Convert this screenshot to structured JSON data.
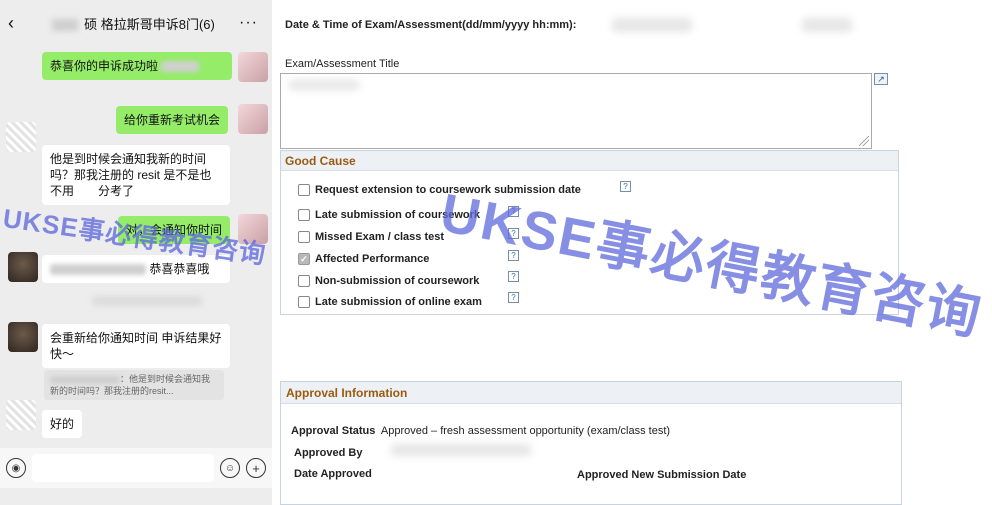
{
  "chat": {
    "header": {
      "back_icon": "‹",
      "title": "硕 格拉斯哥申诉8门(6)",
      "more_icon": "···"
    },
    "messages": [
      {
        "side": "self",
        "text": "恭喜你的申诉成功啦"
      },
      {
        "side": "self",
        "text": "给你重新考试机会"
      },
      {
        "side": "other",
        "text": "他是到时候会通知我新的时间吗？那我注册的 resit 是不是也不用　　分考了"
      },
      {
        "side": "self",
        "text": "对，会通知你时间"
      },
      {
        "side": "other",
        "text": "恭喜恭喜哦"
      },
      {
        "side": "other",
        "text": "会重新给你通知时间 申诉结果好快～"
      },
      {
        "side": "quote",
        "text": "：他是到时候会通知我新的时间吗？那我注册的resit..."
      },
      {
        "side": "other",
        "text": "好的"
      }
    ],
    "input": {
      "voice_icon": "voice-icon",
      "emoji_icon": "emoji-icon",
      "plus_icon": "plus-icon"
    }
  },
  "form": {
    "date_label": "Date & Time of Exam/Assessment(dd/mm/yyyy hh:mm):",
    "title_label": "Exam/Assessment Title",
    "good_cause": {
      "heading": "Good Cause",
      "options": [
        {
          "label": "Request extension to coursework submission date",
          "checked": false
        },
        {
          "label": "Late submission of coursework",
          "checked": false
        },
        {
          "label": "Missed Exam / class test",
          "checked": false
        },
        {
          "label": "Affected Performance",
          "checked": true
        },
        {
          "label": "Non-submission of coursework",
          "checked": false
        },
        {
          "label": "Late submission of online exam",
          "checked": false
        }
      ],
      "help_glyph": "?"
    },
    "approval": {
      "heading": "Approval Information",
      "status_label": "Approval Status",
      "status_value": "Approved – fresh assessment opportunity (exam/class test)",
      "approved_by_label": "Approved By",
      "date_approved_label": "Date Approved",
      "new_submission_label": "Approved New Submission Date"
    }
  },
  "watermark": {
    "text": "UKSE事必得教育咨询",
    "color": "#5f69dc"
  }
}
